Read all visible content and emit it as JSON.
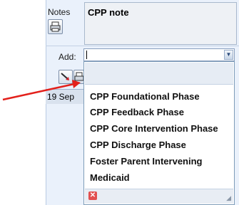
{
  "notes": {
    "label": "Notes",
    "note_text": "CPP note",
    "print_icon": "printer-icon"
  },
  "add": {
    "label": "Add:",
    "value": "",
    "dropdown_icon": "chevron-down-icon",
    "tool_icons": [
      "arrow-tool-icon",
      "printer-icon"
    ]
  },
  "date_cell": "19 Sep",
  "dropdown": {
    "items": [
      "CPP Foundational Phase",
      "CPP Feedback Phase",
      "CPP Core Intervention Phase",
      "CPP Discharge Phase",
      "Foster Parent Intervening",
      "Medicaid"
    ],
    "close_icon": "close-icon",
    "resize_icon": "resize-grip-icon"
  },
  "annotation": {
    "arrow_color": "#e3201b"
  }
}
